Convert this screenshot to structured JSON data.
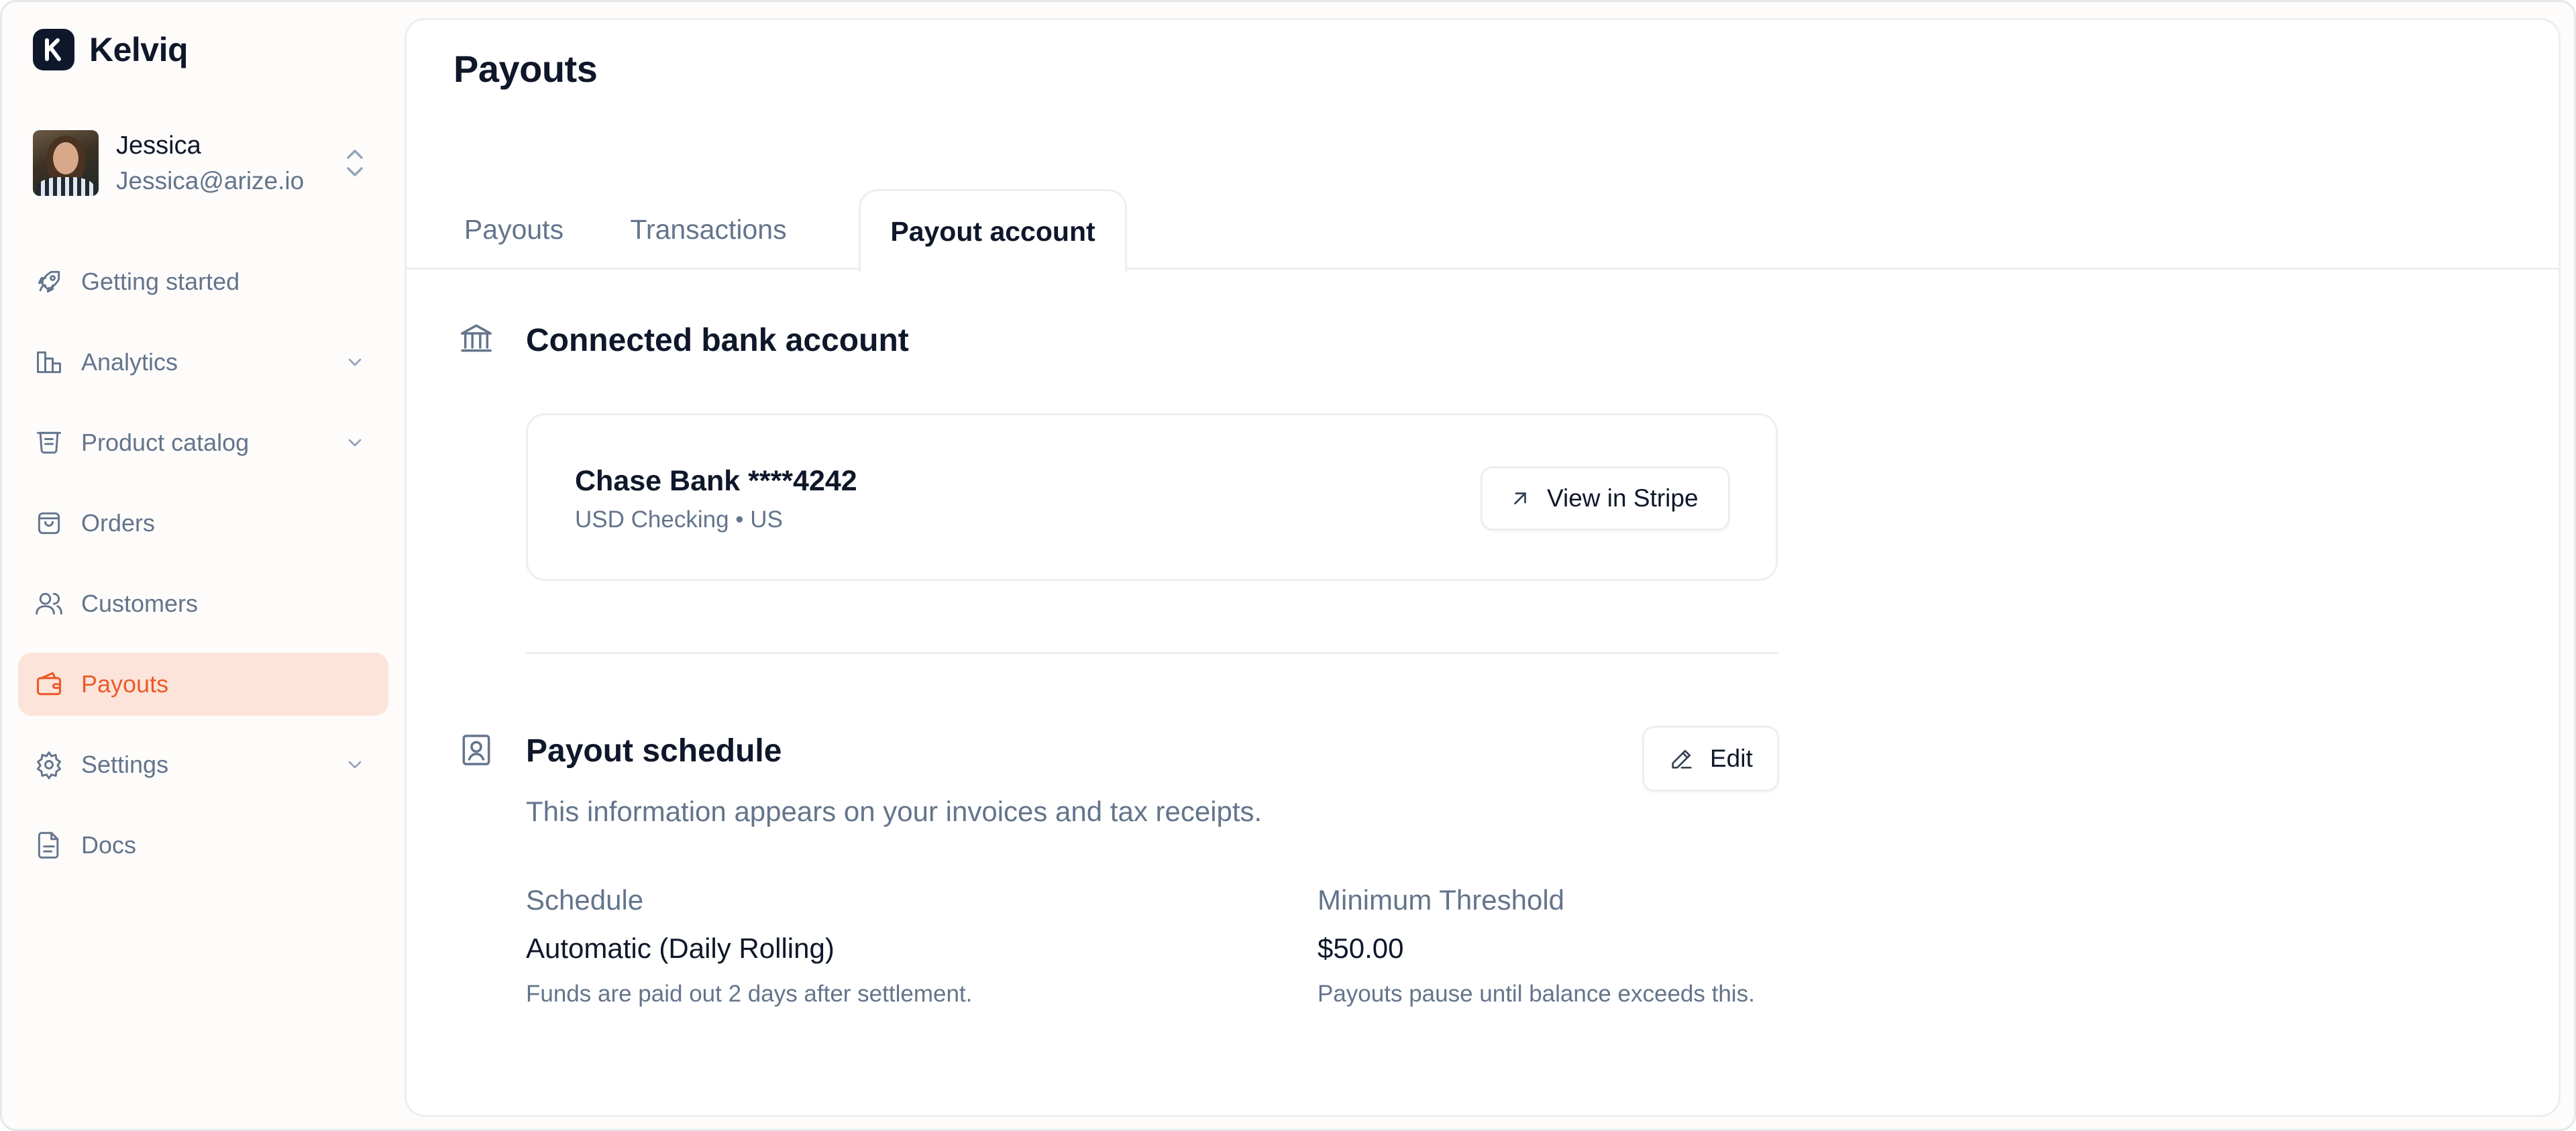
{
  "app": {
    "name": "Kelviq",
    "logo_letter": "K"
  },
  "user": {
    "name": "Jessica",
    "email": "Jessica@arize.io"
  },
  "nav": [
    {
      "label": "Getting started",
      "icon": "rocket-icon"
    },
    {
      "label": "Analytics",
      "icon": "bar-chart-icon"
    },
    {
      "label": "Product catalog",
      "icon": "catalog-icon"
    },
    {
      "label": "Orders",
      "icon": "shopping-bag-icon"
    },
    {
      "label": "Customers",
      "icon": "users-icon"
    },
    {
      "label": "Payouts",
      "icon": "wallet-icon"
    },
    {
      "label": "Settings",
      "icon": "gear-icon"
    },
    {
      "label": "Docs",
      "icon": "document-icon"
    }
  ],
  "page": {
    "title": "Payouts"
  },
  "tabs": [
    {
      "label": "Payouts"
    },
    {
      "label": "Transactions"
    },
    {
      "label": "Payout account"
    }
  ],
  "bank_section": {
    "title": "Connected bank account",
    "bank_name": "Chase Bank ****4242",
    "bank_details": "USD Checking • US",
    "view_button": "View in Stripe"
  },
  "schedule_section": {
    "title": "Payout schedule",
    "description": "This information appears on your invoices and tax receipts.",
    "edit_button": "Edit",
    "schedule_label": "Schedule",
    "schedule_value": "Automatic (Daily Rolling)",
    "schedule_hint": "Funds are paid out 2 days after settlement.",
    "threshold_label": "Minimum Threshold",
    "threshold_value": "$50.00",
    "threshold_hint": "Payouts pause until balance exceeds this."
  },
  "colors": {
    "accent": "#ea5b2a",
    "accent_bg": "#fde4da",
    "text_primary": "#0f172a",
    "text_muted": "#64748b",
    "border": "#eceef1"
  }
}
